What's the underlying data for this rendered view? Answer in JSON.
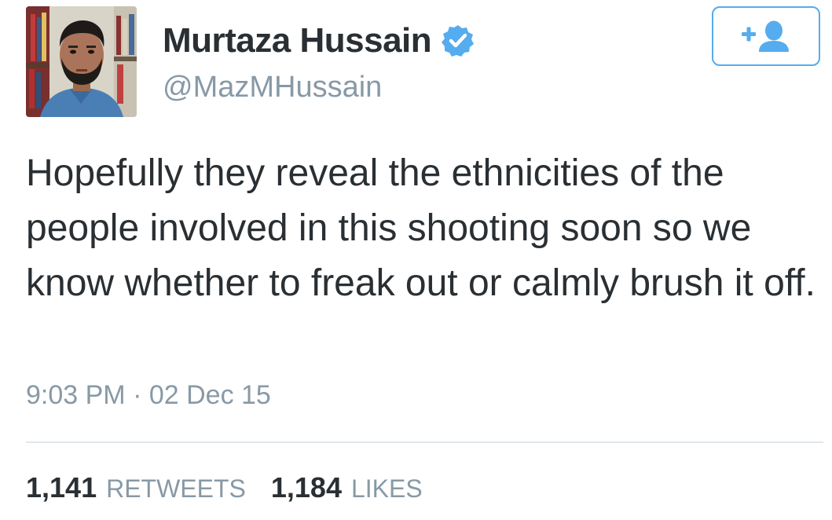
{
  "user": {
    "display_name": "Murtaza Hussain",
    "handle": "@MazMHussain",
    "verified": true
  },
  "tweet": {
    "text": "Hopefully they reveal the ethnicities of the people involved in this shooting soon so we know whether to freak out or calmly brush it off.",
    "timestamp": "9:03 PM · 02 Dec 15"
  },
  "stats": {
    "retweets_count": "1,141",
    "retweets_label": "RETWEETS",
    "likes_count": "1,184",
    "likes_label": "LIKES"
  },
  "icons": {
    "verified": "verified-badge-icon",
    "follow": "add-user-icon"
  },
  "colors": {
    "accent": "#55acee",
    "text": "#292f33",
    "muted": "#8899a6",
    "divider": "#e1e8ed"
  }
}
